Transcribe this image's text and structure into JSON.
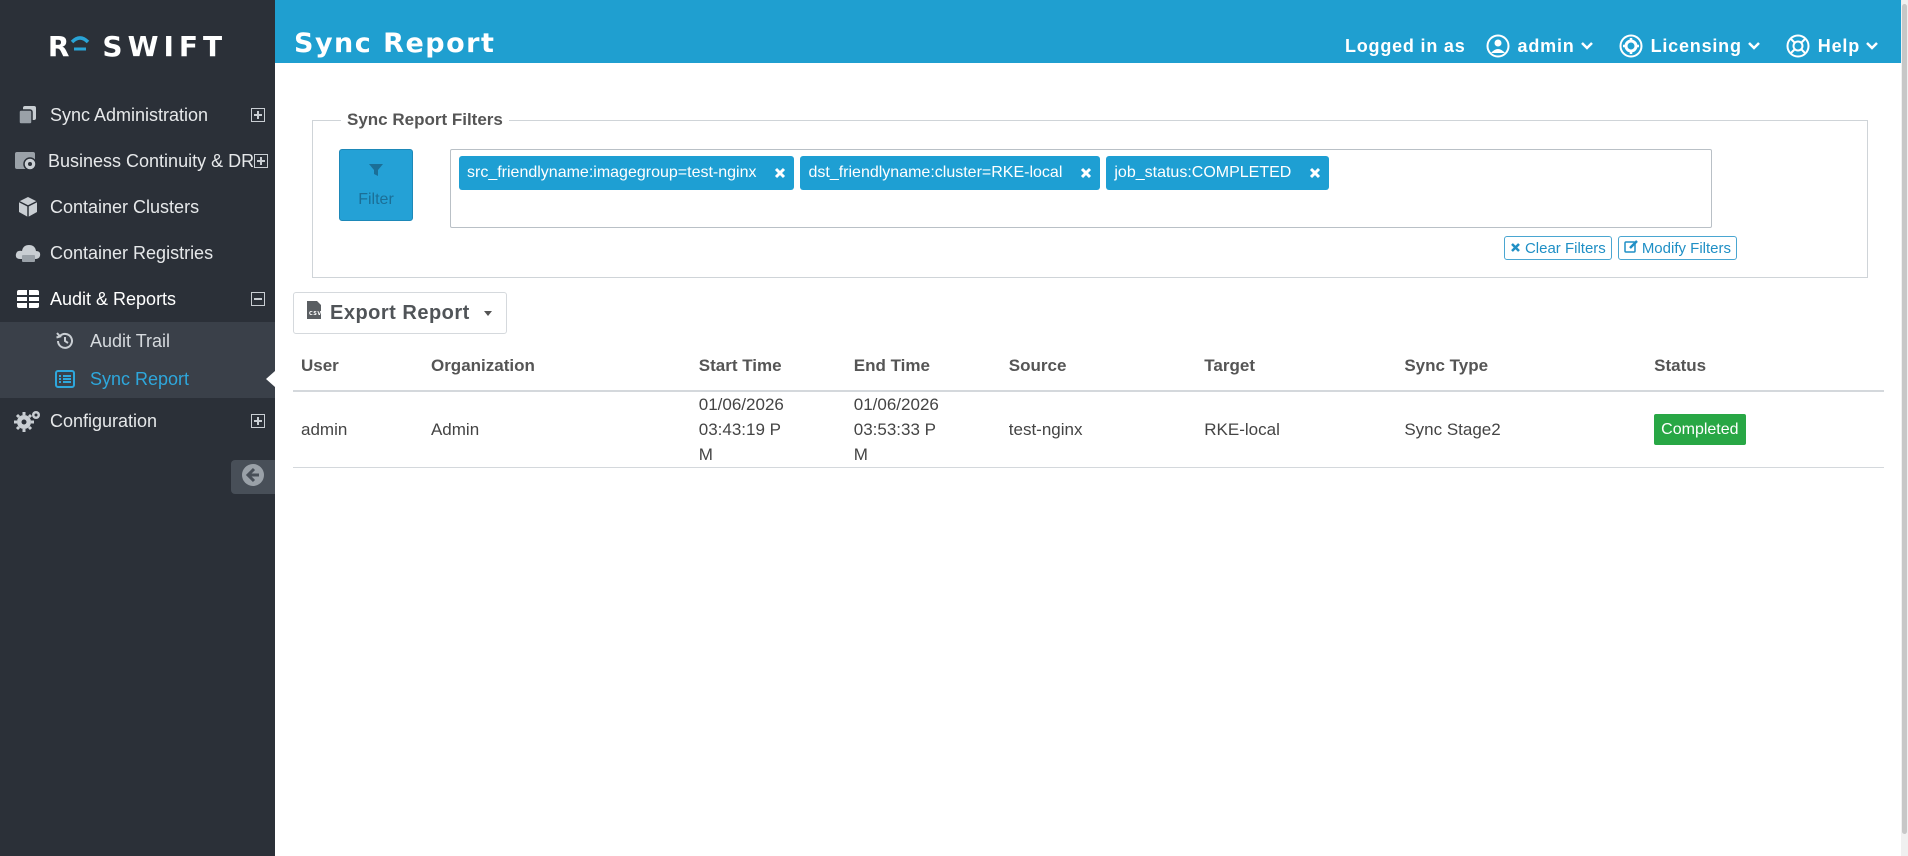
{
  "app": {
    "logo_mark": "R",
    "logo_text": "SWIFT"
  },
  "sidebar": {
    "items": [
      {
        "label": "Sync Administration",
        "icon": "copy-icon",
        "expander": "plus"
      },
      {
        "label": "Business Continuity & DR",
        "icon": "dr-gear-icon",
        "expander": "plus"
      },
      {
        "label": "Container Clusters",
        "icon": "cube-icon"
      },
      {
        "label": "Container Registries",
        "icon": "cloud-server-icon"
      },
      {
        "label": "Audit & Reports",
        "icon": "table-icon",
        "expander": "minus"
      },
      {
        "label": "Configuration",
        "icon": "gears-icon",
        "expander": "plus"
      }
    ],
    "subitems": [
      {
        "label": "Audit Trail",
        "icon": "history-icon"
      },
      {
        "label": "Sync Report",
        "icon": "list-icon",
        "active": true
      }
    ],
    "collapse_icon": "arrow-left-circle-icon"
  },
  "header": {
    "title": "Sync Report",
    "logged_in_as": "Logged in as",
    "user": "admin",
    "licensing": "Licensing",
    "help": "Help",
    "accent_color": "#1f9fd0"
  },
  "filters": {
    "legend": "Sync Report Filters",
    "filter_button": "Filter",
    "tags": [
      "src_friendlyname:imagegroup=test-nginx",
      "dst_friendlyname:cluster=RKE-local",
      "job_status:COMPLETED"
    ],
    "clear": "Clear Filters",
    "modify": "Modify Filters"
  },
  "export": {
    "label": "Export Report",
    "icon": "csv-file-icon"
  },
  "table": {
    "headers": [
      "User",
      "Organization",
      "Start Time",
      "End Time",
      "Source",
      "Target",
      "Sync Type",
      "Status"
    ],
    "rows": [
      {
        "user": "admin",
        "organization": "Admin",
        "start_line1": "01/06/2026 03:43:19 P",
        "start_line2": "M",
        "end_line1": "01/06/2026 03:53:33 P",
        "end_line2": "M",
        "source": "test-nginx",
        "target": "RKE-local",
        "sync_type": "Sync Stage2",
        "status": "Completed",
        "status_color": "#28a745"
      }
    ]
  }
}
